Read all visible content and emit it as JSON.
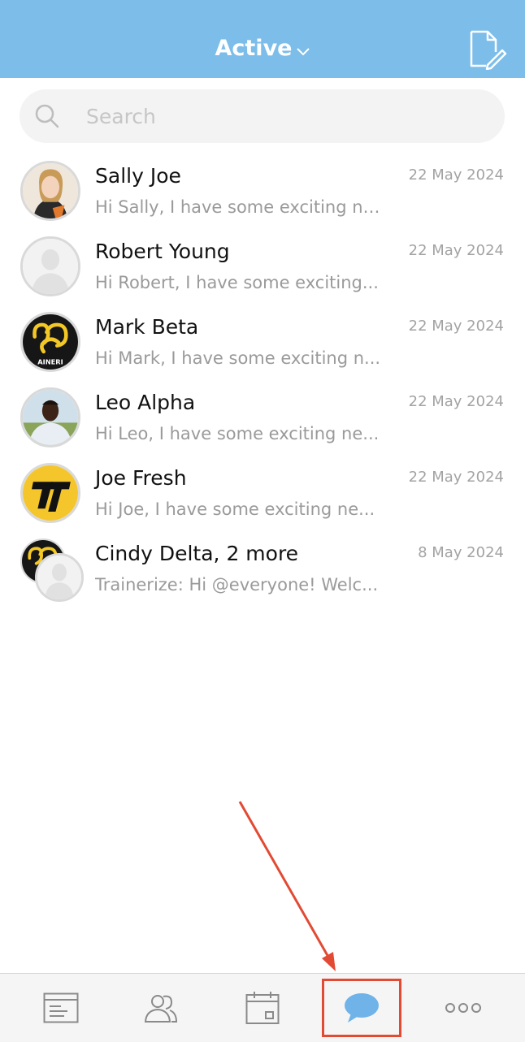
{
  "header": {
    "title": "Active"
  },
  "search": {
    "placeholder": "Search"
  },
  "conversations": [
    {
      "name": "Sally Joe",
      "preview": "Hi Sally, I have some exciting ne...",
      "date": "22 May 2024"
    },
    {
      "name": "Robert Young",
      "preview": "Hi Robert, I have some exciting...",
      "date": "22 May 2024"
    },
    {
      "name": "Mark Beta",
      "preview": "Hi Mark, I have some exciting n...",
      "date": "22 May 2024"
    },
    {
      "name": "Leo Alpha",
      "preview": "Hi Leo, I have some exciting ne...",
      "date": "22 May 2024"
    },
    {
      "name": "Joe Fresh",
      "preview": "Hi Joe, I have some exciting ne...",
      "date": "22 May 2024"
    },
    {
      "name": "Cindy Delta, 2 more",
      "preview": "Trainerize: Hi @everyone! Welc...",
      "date": "8 May 2024"
    }
  ],
  "tabbar": {
    "tabs": [
      {
        "icon": "dashboard-icon"
      },
      {
        "icon": "clients-icon"
      },
      {
        "icon": "calendar-icon"
      },
      {
        "icon": "messages-icon",
        "selected": true
      },
      {
        "icon": "more-icon"
      }
    ]
  },
  "colors": {
    "header": "#7cbde9",
    "accent": "#6fb3e8",
    "annotation": "#e24a34"
  }
}
